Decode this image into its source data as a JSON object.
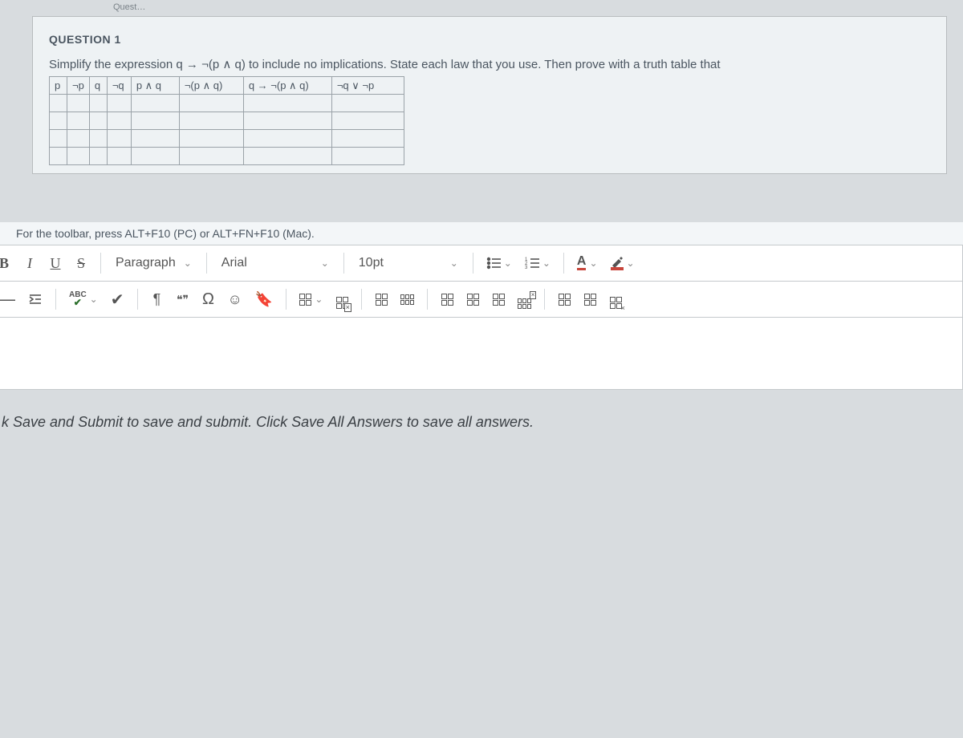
{
  "tab_hint": "Quest…",
  "question": {
    "label": "QUESTION 1",
    "prompt": "Simplify the expression q → ¬(p ∧ q) to include no implications. State each law that you use. Then prove with a truth table that",
    "table_headers": [
      "p",
      "¬p",
      "q",
      "¬q",
      "p ∧ q",
      "¬(p ∧ q)",
      "q → ¬(p ∧ q)",
      "¬q ∨ ¬p"
    ]
  },
  "toolbar": {
    "hint": "For the toolbar, press ALT+F10 (PC) or ALT+FN+F10 (Mac).",
    "bold": "B",
    "italic": "I",
    "underline": "U",
    "strike": "S",
    "paragraph": "Paragraph",
    "font": "Arial",
    "size": "10pt",
    "text_color": "A",
    "abc": "ABC",
    "paragraph_mark": "¶",
    "quote": "❝❞",
    "omega": "Ω",
    "emoji": "☺",
    "bookmark": "▮"
  },
  "footer": "k Save and Submit to save and submit. Click Save All Answers to save all answers."
}
